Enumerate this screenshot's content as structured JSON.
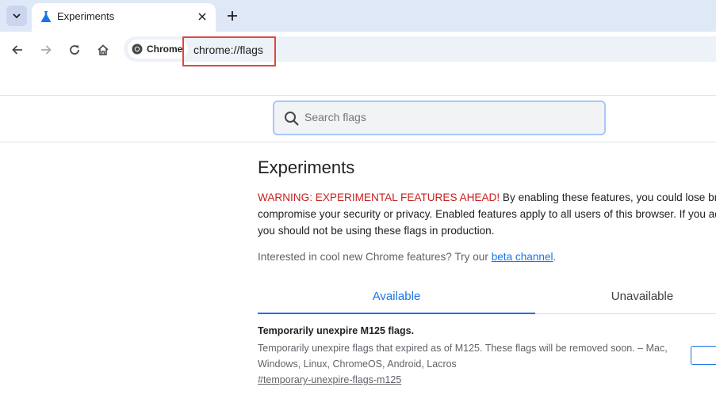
{
  "browser": {
    "tab_title": "Experiments",
    "omnibox_chip": "Chrome",
    "url": "chrome://flags"
  },
  "search": {
    "placeholder": "Search flags"
  },
  "page": {
    "title": "Experiments",
    "warning_label": "WARNING: EXPERIMENTAL FEATURES AHEAD!",
    "warning_text": " By enabling these features, you could lose brow compromise your security or privacy. Enabled features apply to all users of this browser. If you admin you should not be using these flags in production.",
    "interested_text": "Interested in cool new Chrome features? Try our ",
    "beta_link": "beta channel",
    "interested_suffix": "."
  },
  "tabs": {
    "available": "Available",
    "unavailable": "Unavailable"
  },
  "flag": {
    "title": "Temporarily unexpire M125 flags.",
    "description": "Temporarily unexpire flags that expired as of M125. These flags will be removed soon. – Mac, Windows, Linux, ChromeOS, Android, Lacros",
    "link": "#temporary-unexpire-flags-m125"
  },
  "colors": {
    "accent": "#1a73e8",
    "warning": "#c5221f",
    "highlight": "#e0463e"
  }
}
